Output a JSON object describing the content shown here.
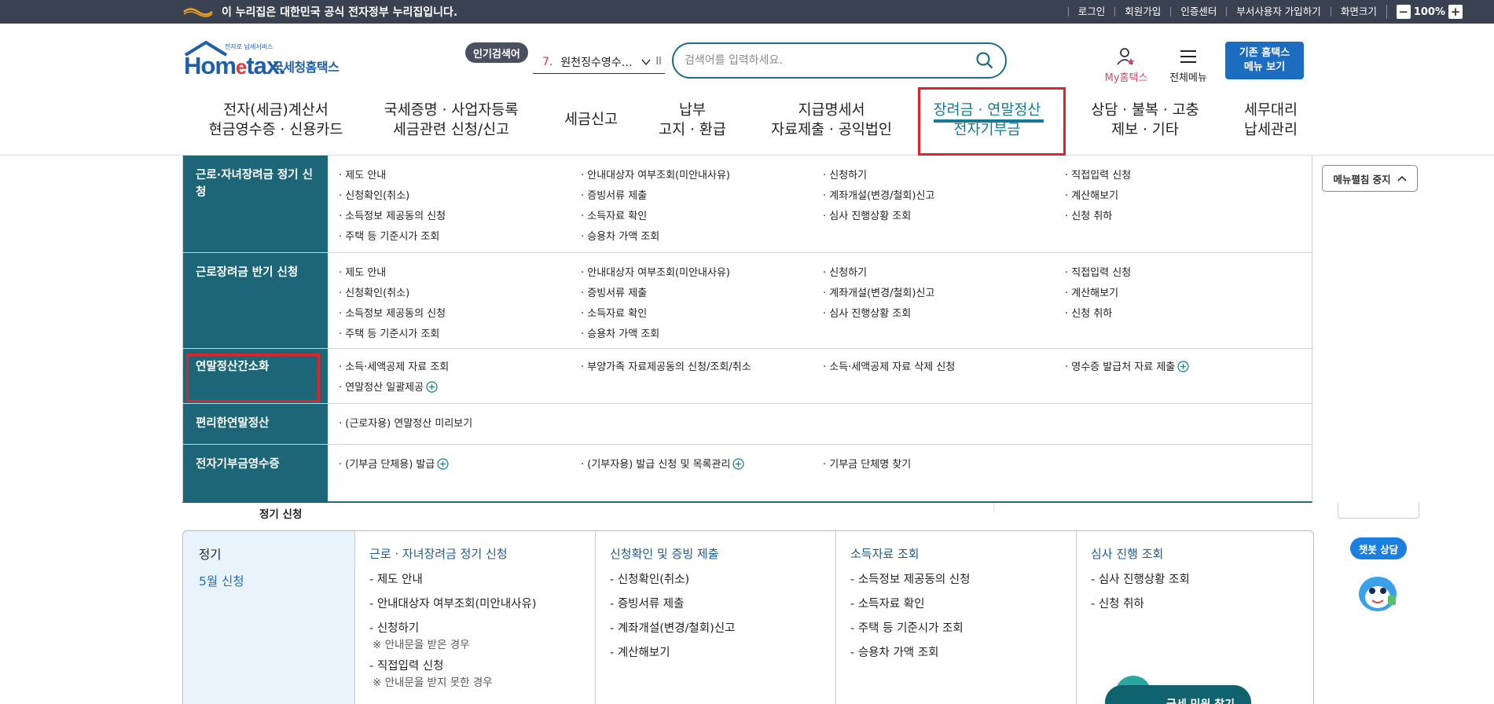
{
  "gov_bar": {
    "notice": "이 누리집은 대한민국 공식 전자정부 누리집입니다.",
    "links": [
      "로그인",
      "회원가입",
      "인증센터",
      "부서사용자 가입하기",
      "화면크기"
    ],
    "zoom_minus": "−",
    "zoom_value": "100%",
    "zoom_plus": "+"
  },
  "header": {
    "logo_small": "전자로 납세서비스",
    "logo_main_1": "Hom",
    "logo_main_e": "e",
    "logo_main_2": "tax.",
    "logo_korean": "국세청홈택스",
    "popular_badge": "인기검색어",
    "popular_num": "7.",
    "popular_text": "원천징수영수…",
    "popular_pause": "II",
    "search_placeholder": "검색어를 입력하세요.",
    "my_hometax": "My홈택스",
    "all_menu": "전체메뉴",
    "old_menu_1": "기존 홈택스",
    "old_menu_2": "메뉴 보기"
  },
  "gnb": [
    {
      "l1": "전자(세금)계산서",
      "l2": "현금영수증 · 신용카드"
    },
    {
      "l1": "국세증명 · 사업자등록",
      "l2": "세금관련 신청/신고"
    },
    {
      "l1": "세금신고",
      "l2": ""
    },
    {
      "l1": "납부",
      "l2": "고지 · 환급"
    },
    {
      "l1": "지급명세서",
      "l2": "자료제출 · 공익법인"
    },
    {
      "l1": "장려금 · 연말정산",
      "l2": "전자기부금"
    },
    {
      "l1": "상담 · 불복 · 고충",
      "l2": "제보 · 기타"
    },
    {
      "l1": "세무대리",
      "l2": "납세관리"
    }
  ],
  "mega": {
    "stop_btn": "메뉴펼침 중지",
    "sections": [
      {
        "title": "근로·자녀장려금 정기 신청",
        "cols": [
          [
            "· 제도 안내",
            "· 신청확인(취소)",
            "· 소득정보 제공동의 신청",
            "· 주택 등 기준시가 조회"
          ],
          [
            "· 안내대상자 여부조회(미안내사유)",
            "· 증빙서류 제출",
            "· 소득자료 확인",
            "· 승용차 가액 조회"
          ],
          [
            "· 신청하기",
            "· 계좌개설(변경/철회)신고",
            "· 심사 진행상황 조회"
          ],
          [
            "· 직접입력 신청",
            "· 계산해보기",
            "· 신청 취하"
          ]
        ]
      },
      {
        "title": "근로장려금 반기 신청",
        "cols": [
          [
            "· 제도 안내",
            "· 신청확인(취소)",
            "· 소득정보 제공동의 신청",
            "· 주택 등 기준시가 조회"
          ],
          [
            "· 안내대상자 여부조회(미안내사유)",
            "· 증빙서류 제출",
            "· 소득자료 확인",
            "· 승용차 가액 조회"
          ],
          [
            "· 신청하기",
            "· 계좌개설(변경/철회)신고",
            "· 심사 진행상황 조회"
          ],
          [
            "· 직접입력 신청",
            "· 계산해보기",
            "· 신청 취하"
          ]
        ]
      },
      {
        "title": "연말정산간소화",
        "cols": [
          [
            "· 소득·세액공제 자료 조회",
            "· 연말정산 일괄제공"
          ],
          [
            "· 부양가족 자료제공동의 신청/조회/취소"
          ],
          [
            "· 소득·세액공제 자료 삭제 신청"
          ],
          [
            "· 영수증 발급처 자료 제출"
          ]
        ]
      },
      {
        "title": "편리한연말정산",
        "cols": [
          [
            "· (근로자용) 연말정산 미리보기"
          ]
        ]
      },
      {
        "title": "전자기부금영수증",
        "cols": [
          [
            "· (기부금 단체용) 발급"
          ],
          [
            "· (기부자용) 발급 신청 및 목록관리"
          ],
          [
            "· 기부금 단체명 찾기"
          ]
        ]
      }
    ]
  },
  "background": {
    "label": "정기 신청",
    "card": {
      "category": "정기",
      "sub": "5월 신청",
      "cols": [
        {
          "head": "근로 · 자녀장려금 정기 신청",
          "items": [
            "- 제도 안내",
            "- 안내대상자 여부조회(미안내사유)",
            "- 신청하기",
            "- 직접입력 신청"
          ],
          "notes": [
            "※ 안내문을 받은 경우",
            "※ 안내문을 받지 못한 경우"
          ]
        },
        {
          "head": "신청확인 및 증빙 제출",
          "items": [
            "- 신청확인(취소)",
            "- 증빙서류 제출",
            "- 계좌개설(변경/철회)신고",
            "- 계산해보기"
          ]
        },
        {
          "head": "소득자료 조회",
          "items": [
            "- 소득정보 제공동의 신청",
            "- 소득자료 확인",
            "- 주택 등 기준시가 조회",
            "- 승용차 가액 조회"
          ]
        },
        {
          "head": "심사 진행 조회",
          "items": [
            "- 심사 진행상황 조회",
            "- 신청 취하"
          ]
        }
      ]
    },
    "chatbot": "챗봇 상담",
    "bottom_float": "국세 민원 찾기"
  },
  "colors": {
    "teal": "#1d6678",
    "accent": "#127a93",
    "highlight": "#e0232b",
    "blue_btn": "#1c6cbf"
  }
}
